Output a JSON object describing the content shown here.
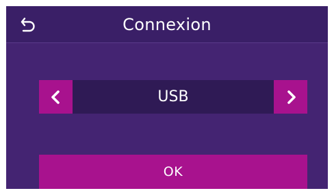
{
  "header": {
    "title": "Connexion",
    "back_icon": "back-arrow-icon"
  },
  "selector": {
    "value": "USB",
    "prev_icon": "chevron-left-icon",
    "next_icon": "chevron-right-icon"
  },
  "actions": {
    "ok_label": "OK"
  },
  "colors": {
    "background": "#442472",
    "header": "#3a1f67",
    "selector_bg": "#2f1a55",
    "accent": "#a8128e",
    "text": "#ffffff"
  }
}
